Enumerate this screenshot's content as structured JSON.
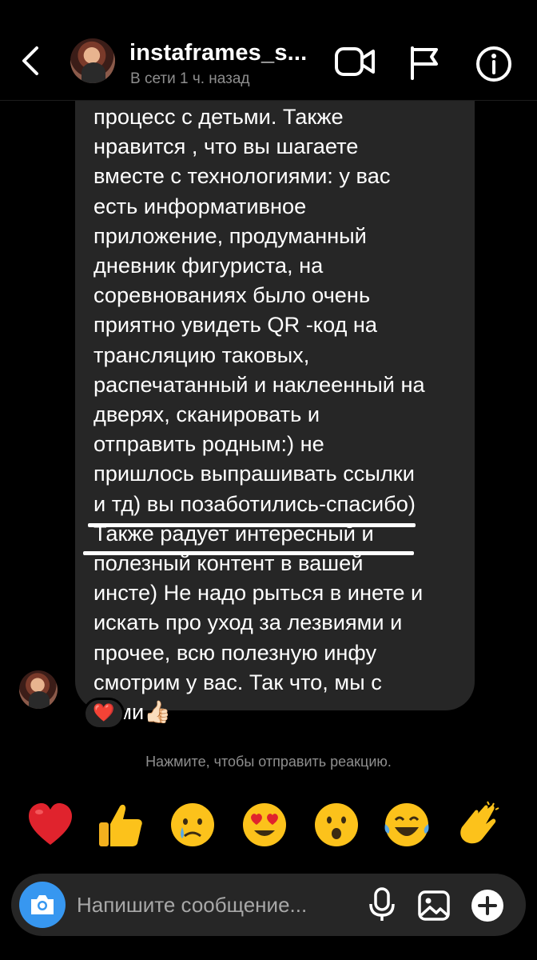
{
  "header": {
    "username": "instaframes_s...",
    "status": "В сети 1 ч. назад"
  },
  "message": {
    "text": "процесс с детьми. Также\nнравится , что вы шагаете\nвместе с технологиями: у вас\nесть информативное\nприложение, продуманный\nдневник фигуриста, на\nсоревнованиях было очень\nприятно увидеть QR -код на\nтрансляцию таковых,\nраспечатанный и наклеенный на\nдверях, сканировать и\nотправить родным:) не\nпришлось выпрашивать ссылки\nи тд) вы позаботились-спасибо)\nТакже радует интересный и\nполезный контент в вашей\nинсте) Не надо рыться в инете и\nискать про уход за лезвиями и\nпрочее, всю полезную инфу\nсмотрим у вас. Так что, мы с\nвами👍🏻",
    "reaction": "❤️"
  },
  "hint": "Нажмите, чтобы отправить реакцию.",
  "reactions": [
    "❤️",
    "👍",
    "😢",
    "😍",
    "😮",
    "😂",
    "👏"
  ],
  "composer": {
    "placeholder": "Напишите сообщение..."
  },
  "colors": {
    "background": "#000000",
    "bubble": "#262626",
    "camera_button": "#3797f0",
    "secondary_text": "#8e8e8e"
  },
  "icons": {
    "back": "chevron-left-icon",
    "video": "video-camera-icon",
    "flag": "flag-icon",
    "info": "info-icon",
    "camera": "camera-icon",
    "mic": "microphone-icon",
    "gallery": "image-gallery-icon",
    "plus": "plus-circle-icon"
  }
}
